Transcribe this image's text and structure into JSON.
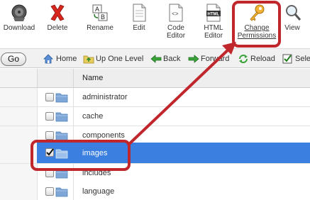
{
  "toolbar": {
    "download": "Download",
    "delete": "Delete",
    "rename": "Rename",
    "edit": "Edit",
    "code_editor_1": "Code",
    "code_editor_2": "Editor",
    "html_editor_1": "HTML",
    "html_editor_2": "Editor",
    "change_perms_1": "Change",
    "change_perms_2": "Permissions",
    "view": "View",
    "html_icon_text": "HTML"
  },
  "navbar": {
    "go": "Go",
    "home": "Home",
    "up_one_level": "Up One Level",
    "back": "Back",
    "forward": "Forward",
    "reload": "Reload",
    "select_all": "Sele"
  },
  "table": {
    "header_name": "Name",
    "rows": [
      {
        "name": "administrator",
        "checked": false
      },
      {
        "name": "cache",
        "checked": false
      },
      {
        "name": "components",
        "checked": false
      },
      {
        "name": "images",
        "checked": true
      },
      {
        "name": "includes",
        "checked": false
      },
      {
        "name": "language",
        "checked": false
      }
    ]
  },
  "colors": {
    "selection": "#3b7fe0",
    "annotation": "#c0272d"
  },
  "icons": [
    "download-icon",
    "delete-icon",
    "rename-icon",
    "edit-icon",
    "code-editor-icon",
    "html-editor-icon",
    "key-icon",
    "magnifier-icon",
    "home-icon",
    "up-folder-icon",
    "back-arrow-icon",
    "forward-arrow-icon",
    "reload-icon",
    "checkbox-icon",
    "folder-icon"
  ]
}
